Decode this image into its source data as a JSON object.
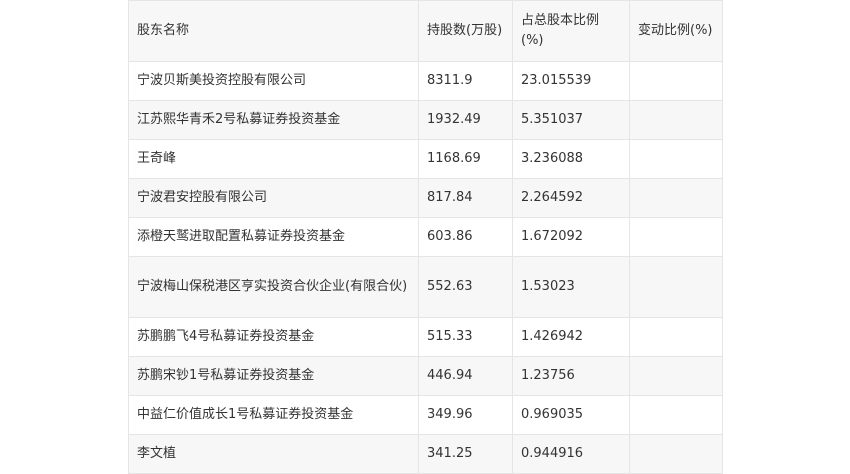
{
  "table": {
    "headers": [
      "股东名称",
      "持股数(万股)",
      "占总股本比例(%)",
      "变动比例(%)"
    ],
    "rows": [
      {
        "name": "宁波贝斯美投资控股有限公司",
        "shares": "8311.9",
        "ratio": "23.015539",
        "change": ""
      },
      {
        "name": "江苏熙华青禾2号私募证券投资基金",
        "shares": "1932.49",
        "ratio": "5.351037",
        "change": ""
      },
      {
        "name": "王奇峰",
        "shares": "1168.69",
        "ratio": "3.236088",
        "change": ""
      },
      {
        "name": "宁波君安控股有限公司",
        "shares": "817.84",
        "ratio": "2.264592",
        "change": ""
      },
      {
        "name": "添橙天鹫进取配置私募证券投资基金",
        "shares": "603.86",
        "ratio": "1.672092",
        "change": ""
      },
      {
        "name": "宁波梅山保税港区亨实投资合伙企业(有限合伙)",
        "shares": "552.63",
        "ratio": "1.53023",
        "change": ""
      },
      {
        "name": "苏鹏鹏飞4号私募证券投资基金",
        "shares": "515.33",
        "ratio": "1.426942",
        "change": ""
      },
      {
        "name": "苏鹏宋钞1号私募证券投资基金",
        "shares": "446.94",
        "ratio": "1.23756",
        "change": ""
      },
      {
        "name": "中益仁价值成长1号私募证券投资基金",
        "shares": "349.96",
        "ratio": "0.969035",
        "change": ""
      },
      {
        "name": "李文植",
        "shares": "341.25",
        "ratio": "0.944916",
        "change": ""
      }
    ]
  }
}
